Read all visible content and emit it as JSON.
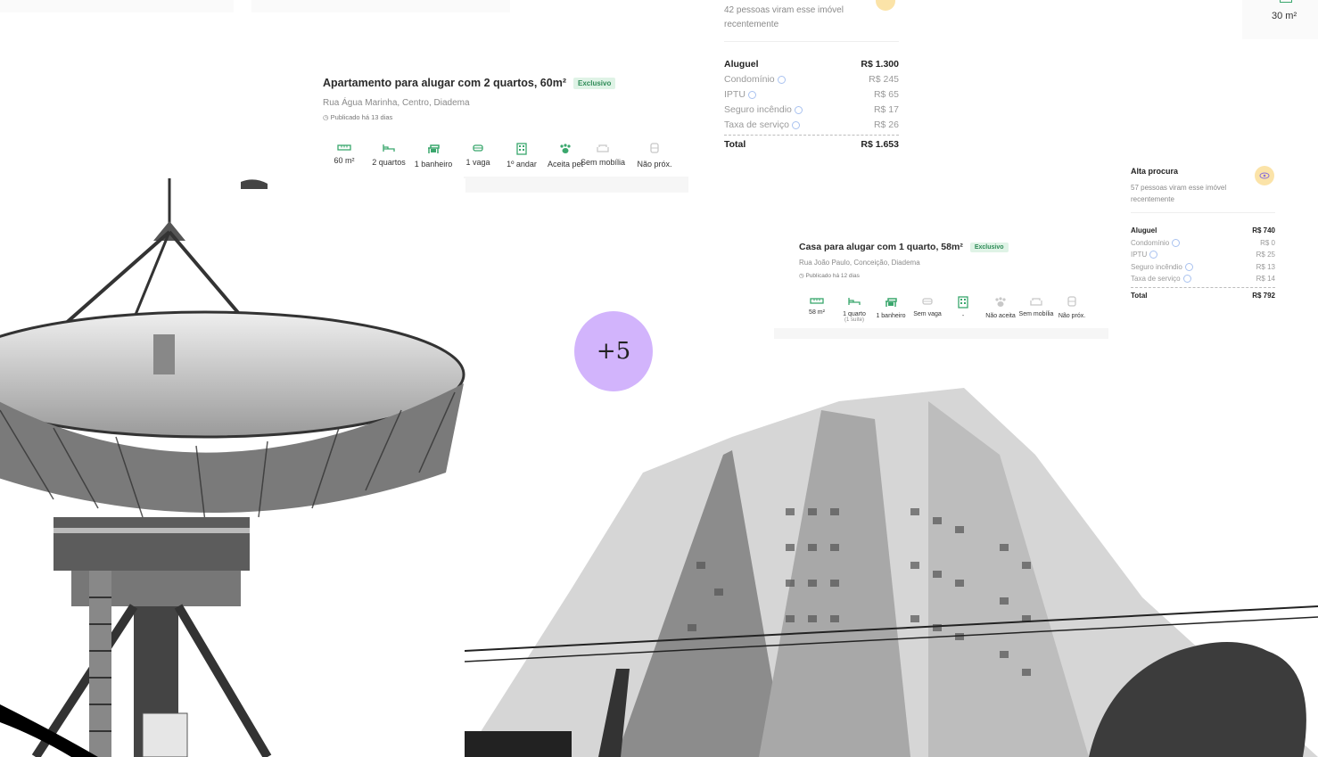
{
  "listing1": {
    "title": "Apartamento para alugar com 2 quartos, 60m²",
    "badge": "Exclusivo",
    "address": "Rua Água Marinha, Centro, Diadema",
    "published": "Publicado há 13 dias",
    "features": [
      {
        "label": "60 m²",
        "icon": "ruler-icon"
      },
      {
        "label": "2 quartos",
        "icon": "bed-icon"
      },
      {
        "label": "1 banheiro",
        "icon": "shower-icon"
      },
      {
        "label": "1 vaga",
        "icon": "car-icon"
      },
      {
        "label": "1º andar",
        "icon": "building-icon"
      },
      {
        "label": "Aceita pet",
        "icon": "paw-icon"
      },
      {
        "label": "Sem mobília",
        "icon": "sofa-icon"
      },
      {
        "label": "Não próx.",
        "icon": "metro-icon"
      }
    ]
  },
  "price1": {
    "viewers": "42 pessoas viram esse imóvel recentemente",
    "rows": [
      {
        "label": "Aluguel",
        "value": "R$ 1.300"
      },
      {
        "label": "Condomínio",
        "value": "R$ 245"
      },
      {
        "label": "IPTU",
        "value": "R$ 65"
      },
      {
        "label": "Seguro incêndio",
        "value": "R$ 17"
      },
      {
        "label": "Taxa de serviço",
        "value": "R$ 26"
      }
    ],
    "total_label": "Total",
    "total_value": "R$ 1.653"
  },
  "corner": {
    "area": "30 m²"
  },
  "listing2": {
    "title": "Casa para alugar com 1 quarto, 58m²",
    "badge": "Exclusivo",
    "address": "Rua João Paulo, Conceição, Diadema",
    "published": "Publicado há 12 dias",
    "features": [
      {
        "label": "58 m²",
        "icon": "ruler-icon"
      },
      {
        "label": "1 quarto",
        "sub": "(1 suíte)",
        "icon": "bed-icon"
      },
      {
        "label": "1 banheiro",
        "icon": "shower-icon"
      },
      {
        "label": "Sem vaga",
        "icon": "car-icon"
      },
      {
        "label": "-",
        "icon": "building-icon"
      },
      {
        "label": "Não aceita",
        "icon": "paw-icon"
      },
      {
        "label": "Sem mobília",
        "icon": "sofa-icon"
      },
      {
        "label": "Não próx.",
        "icon": "metro-icon"
      }
    ]
  },
  "price2": {
    "demand": "Alta procura",
    "viewers": "57 pessoas viram esse imóvel recentemente",
    "rows": [
      {
        "label": "Aluguel",
        "value": "R$ 740"
      },
      {
        "label": "Condomínio",
        "value": "R$ 0"
      },
      {
        "label": "IPTU",
        "value": "R$ 25"
      },
      {
        "label": "Seguro incêndio",
        "value": "R$ 13"
      },
      {
        "label": "Taxa de serviço",
        "value": "R$ 14"
      }
    ],
    "total_label": "Total",
    "total_value": "R$ 792"
  },
  "more_badge": "+5",
  "colors": {
    "accent_green": "#2e8b57",
    "badge_bg": "#dff3e6",
    "purple": "#d2b4fc",
    "eye_bg": "#fbe3a8"
  }
}
